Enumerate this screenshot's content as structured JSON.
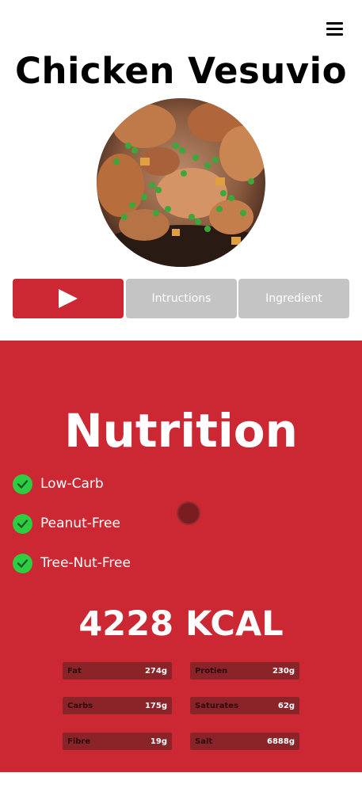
{
  "header": {
    "menu_icon": "hamburger-menu-icon"
  },
  "recipe": {
    "title": "Chicken Vesuvio"
  },
  "tabs": [
    {
      "type": "video",
      "icon": "play-icon",
      "label": ""
    },
    {
      "type": "instructions",
      "label": "Intructions"
    },
    {
      "type": "ingredients",
      "label": "Ingredient"
    }
  ],
  "nutrition": {
    "heading": "Nutrition",
    "diet_labels": [
      "Low-Carb",
      "Peanut-Free",
      "Tree-Nut-Free"
    ],
    "calories": "4228 KCAL",
    "nutrients": [
      {
        "label": "Fat",
        "value": "274g"
      },
      {
        "label": "Protien",
        "value": "230g"
      },
      {
        "label": "Carbs",
        "value": "175g"
      },
      {
        "label": "Saturates",
        "value": "62g"
      },
      {
        "label": "Fibre",
        "value": "19g"
      },
      {
        "label": "Salt",
        "value": "6888g"
      }
    ]
  },
  "colors": {
    "accent": "#cc2833",
    "tab_inactive": "#c4c4c4",
    "check": "#2ecc40",
    "nutrient_chip": "#8b2428"
  }
}
